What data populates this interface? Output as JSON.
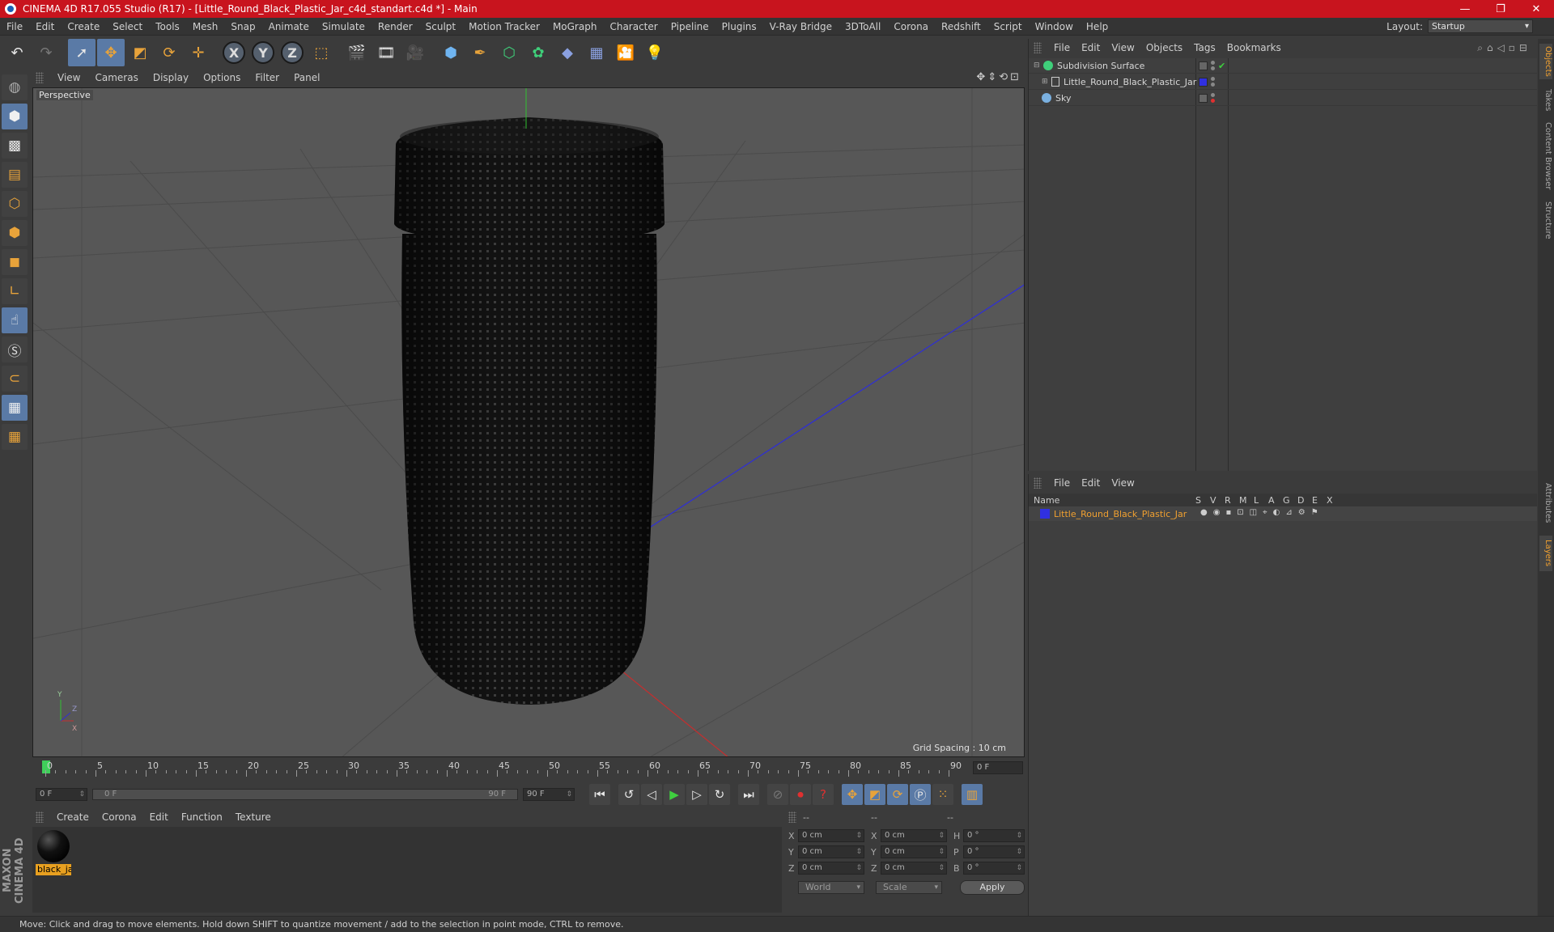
{
  "window": {
    "title": "CINEMA 4D R17.055 Studio (R17) - [Little_Round_Black_Plastic_Jar_c4d_standart.c4d *] - Main",
    "controls": [
      "—",
      "❐",
      "✕"
    ]
  },
  "menubar": {
    "items": [
      "File",
      "Edit",
      "Create",
      "Select",
      "Tools",
      "Mesh",
      "Snap",
      "Animate",
      "Simulate",
      "Render",
      "Sculpt",
      "Motion Tracker",
      "MoGraph",
      "Character",
      "Pipeline",
      "Plugins",
      "V-Ray Bridge",
      "3DToAll",
      "Corona",
      "Redshift",
      "Script",
      "Window",
      "Help"
    ],
    "layout_label": "Layout:",
    "layout_value": "Startup"
  },
  "viewport": {
    "menu": [
      "View",
      "Cameras",
      "Display",
      "Options",
      "Filter",
      "Panel"
    ],
    "camera_label": "Perspective",
    "grid_spacing": "Grid Spacing : 10 cm",
    "nav_icons": "✥⇕⟲⊡"
  },
  "timeline": {
    "ticks": [
      "0",
      "5",
      "10",
      "15",
      "20",
      "25",
      "30",
      "35",
      "40",
      "45",
      "50",
      "55",
      "60",
      "65",
      "70",
      "75",
      "80",
      "85",
      "90"
    ],
    "current_frame": "0 F"
  },
  "transport": {
    "start_field": "0 F",
    "range_start": "0 F",
    "range_end": "90 F",
    "end_field": "90 F"
  },
  "material_manager": {
    "menu": [
      "Create",
      "Corona",
      "Edit",
      "Function",
      "Texture"
    ],
    "materials": [
      {
        "name": "black_ja"
      }
    ]
  },
  "coord_manager": {
    "head": [
      "--",
      "--",
      "--"
    ],
    "rows": [
      {
        "axis1": "X",
        "val1": "0 cm",
        "axis2": "X",
        "val2": "0 cm",
        "axis3": "H",
        "val3": "0 °"
      },
      {
        "axis1": "Y",
        "val1": "0 cm",
        "axis2": "Y",
        "val2": "0 cm",
        "axis3": "P",
        "val3": "0 °"
      },
      {
        "axis1": "Z",
        "val1": "0 cm",
        "axis2": "Z",
        "val2": "0 cm",
        "axis3": "B",
        "val3": "0 °"
      }
    ],
    "mode": "World",
    "type": "Scale",
    "apply": "Apply"
  },
  "object_manager": {
    "menu": [
      "File",
      "Edit",
      "View",
      "Objects",
      "Tags",
      "Bookmarks"
    ],
    "objects": [
      {
        "name": "Subdivision Surface"
      },
      {
        "name": "Little_Round_Black_Plastic_Jar"
      },
      {
        "name": "Sky"
      }
    ]
  },
  "layer_manager": {
    "menu": [
      "File",
      "Edit",
      "View"
    ],
    "columns": [
      "Name",
      "S",
      "V",
      "R",
      "M",
      "L",
      "A",
      "G",
      "D",
      "E",
      "X"
    ],
    "layers": [
      {
        "name": "Little_Round_Black_Plastic_Jar"
      }
    ]
  },
  "side_tabs": {
    "top": [
      "Objects",
      "Takes",
      "Content Browser",
      "Structure"
    ],
    "bottom": [
      "Attributes",
      "Layers"
    ]
  },
  "status": {
    "text": "Move: Click and drag to move elements. Hold down SHIFT to quantize movement / add to the selection in point mode, CTRL to remove."
  },
  "brand": {
    "logo_text": "MAXON CINEMA 4D"
  },
  "colors": {
    "title_bar": "#c8141e",
    "selected_tool": "#5a7aa6",
    "layer_text": "#f0a030",
    "axis_x": "#c03030",
    "axis_y": "#30c030",
    "axis_z": "#3030d0"
  }
}
